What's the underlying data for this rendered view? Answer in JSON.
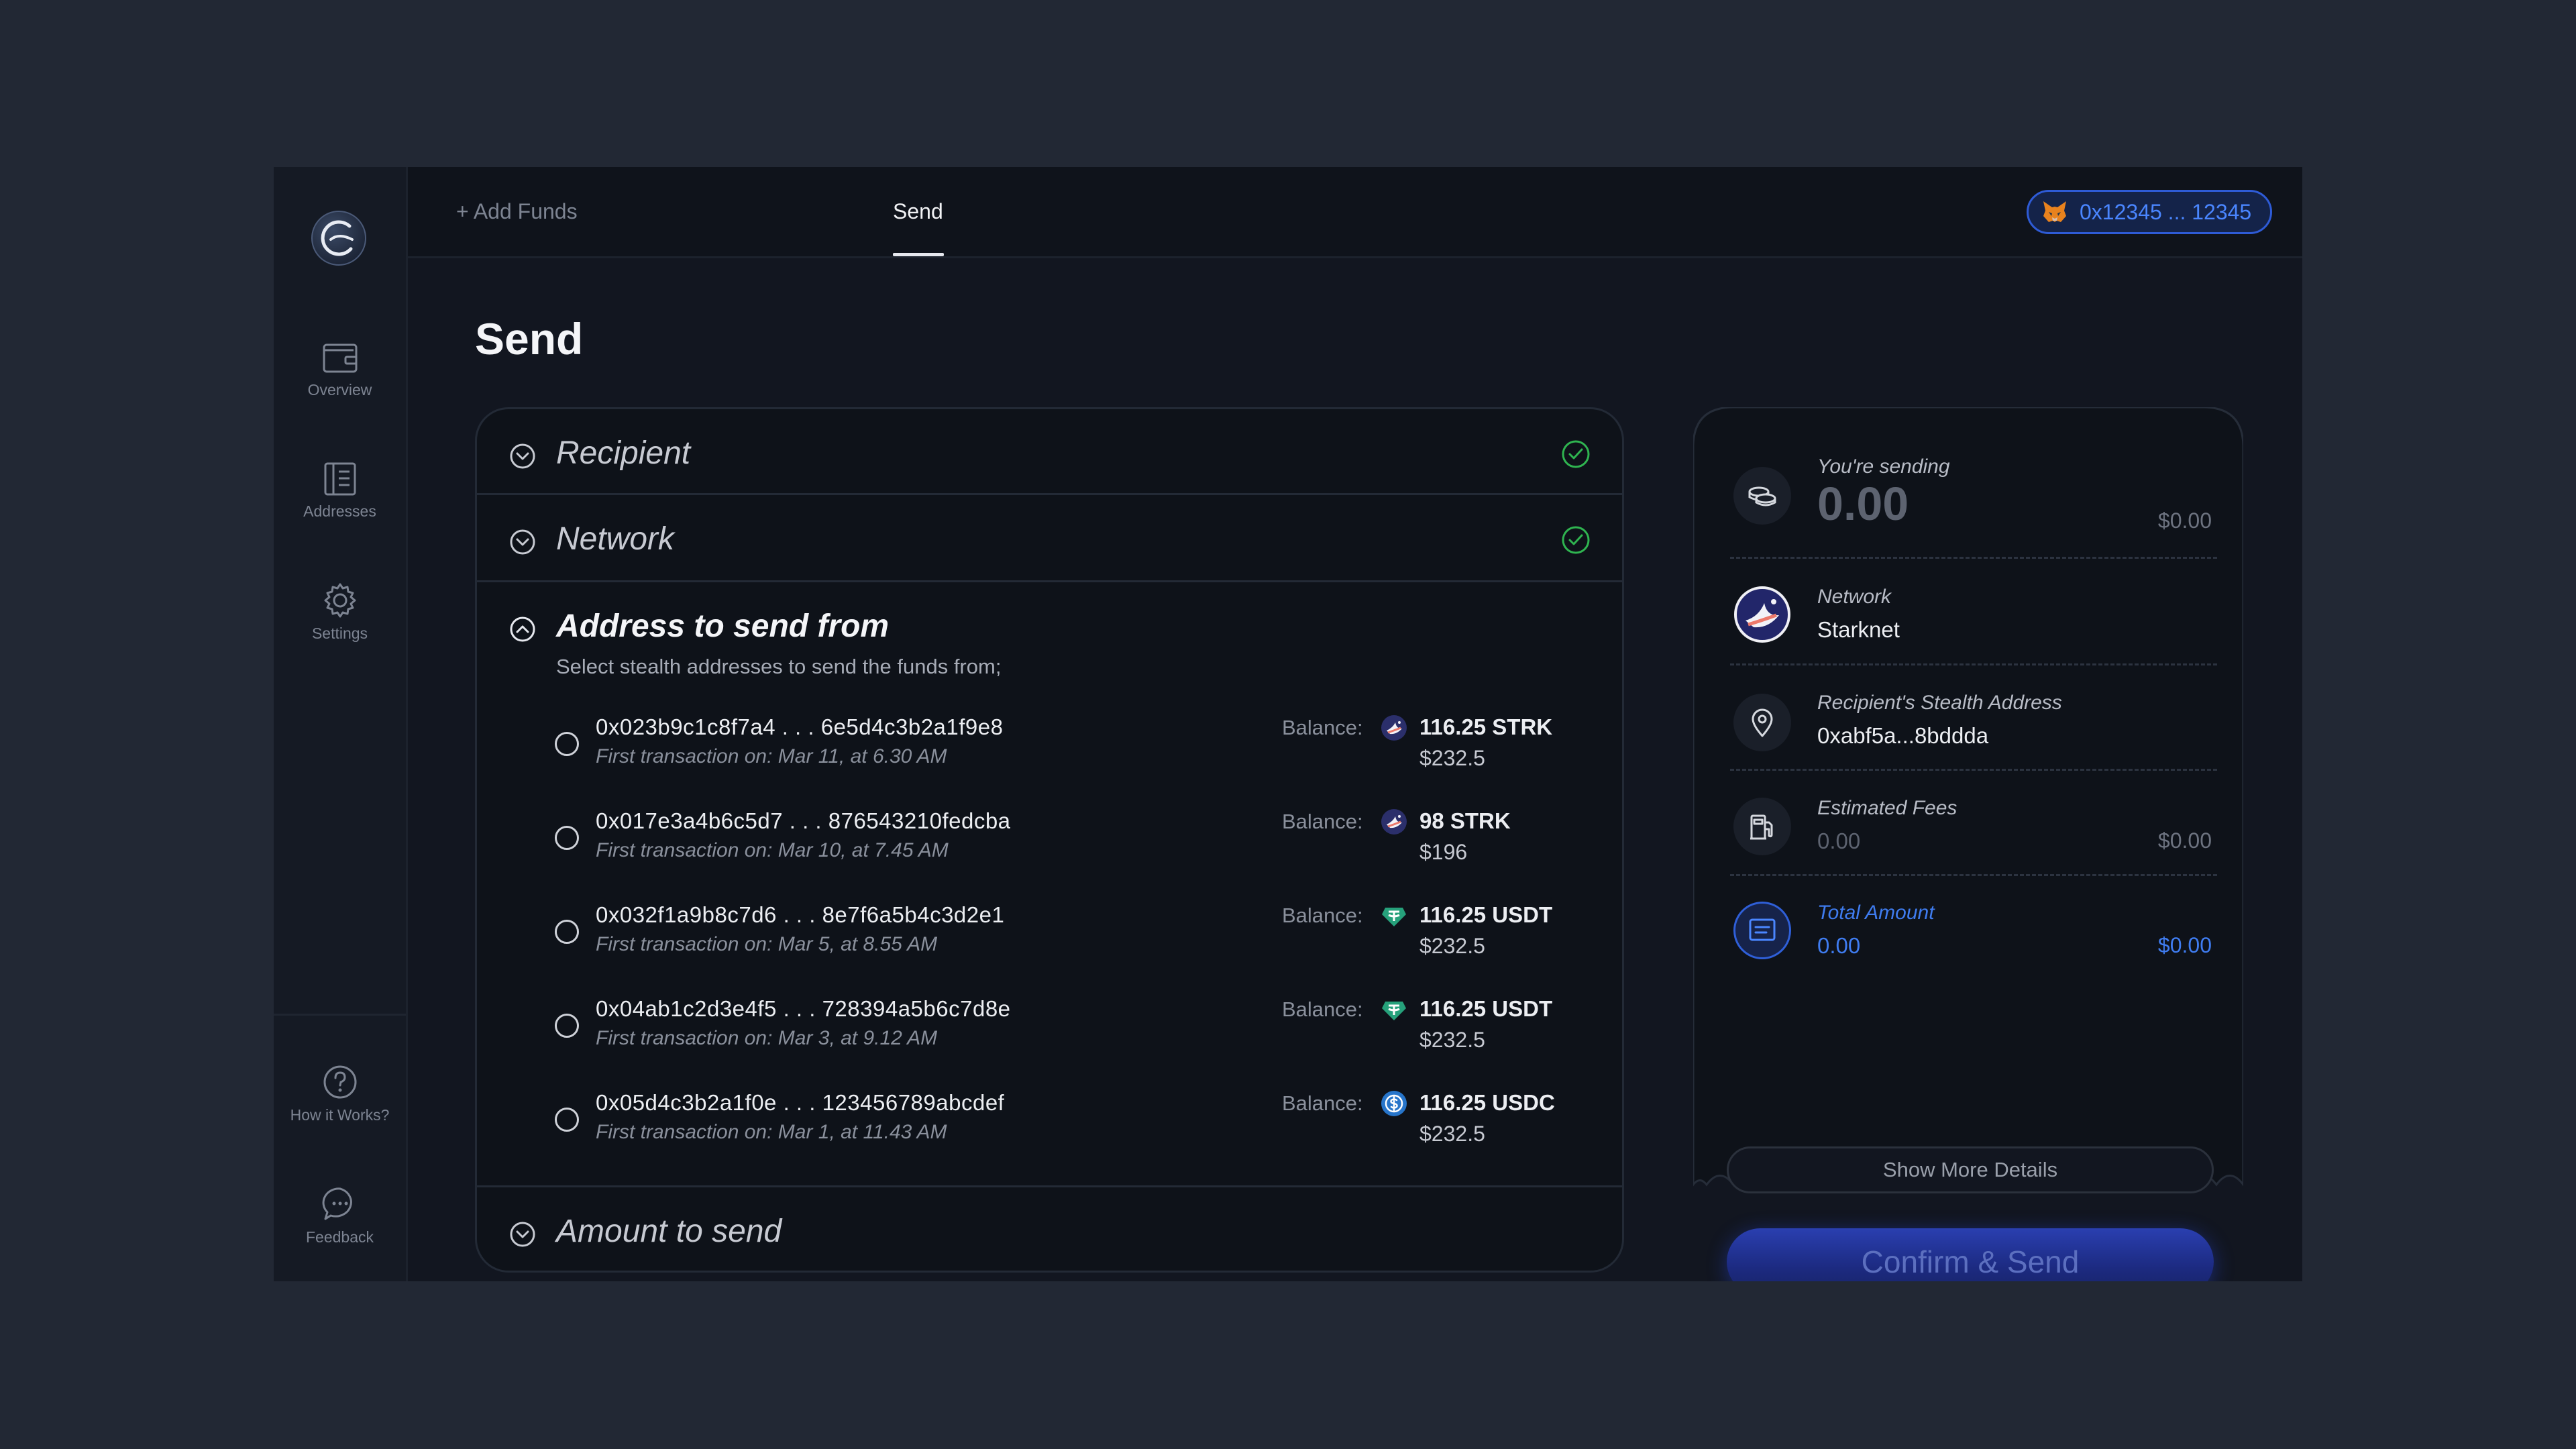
{
  "sidebar": {
    "items": [
      {
        "label": "Overview",
        "icon": "wallet-icon"
      },
      {
        "label": "Addresses",
        "icon": "addresses-icon"
      },
      {
        "label": "Settings",
        "icon": "gear-icon"
      }
    ],
    "bottom_items": [
      {
        "label": "How it Works?",
        "icon": "help-icon"
      },
      {
        "label": "Feedback",
        "icon": "feedback-icon"
      }
    ]
  },
  "topbar": {
    "tabs": [
      {
        "label": "+ Add Funds"
      },
      {
        "label": "Send",
        "active": true
      }
    ],
    "wallet": "0x12345 ... 12345"
  },
  "page": {
    "title": "Send"
  },
  "accordion": {
    "recipient": "Recipient",
    "network": "Network",
    "address_from": "Address to send from",
    "address_from_subtitle": "Select stealth addresses to send the funds from;",
    "amount": "Amount to send",
    "balance_label": "Balance:",
    "addresses": [
      {
        "address": "0x023b9c1c8f7a4 . . . 6e5d4c3b2a1f9e8",
        "first_tx": "First transaction on: Mar 11, at 6.30 AM",
        "token": "116.25 STRK",
        "usd": "$232.5",
        "token_icon": "starknet-icon"
      },
      {
        "address": "0x017e3a4b6c5d7 . . . 876543210fedcba",
        "first_tx": "First transaction on: Mar 10, at 7.45 AM",
        "token": "98 STRK",
        "usd": "$196",
        "token_icon": "starknet-icon"
      },
      {
        "address": "0x032f1a9b8c7d6 . . . 8e7f6a5b4c3d2e1",
        "first_tx": "First transaction on: Mar 5, at 8.55 AM",
        "token": "116.25 USDT",
        "usd": "$232.5",
        "token_icon": "usdt-icon"
      },
      {
        "address": "0x04ab1c2d3e4f5 . . . 728394a5b6c7d8e",
        "first_tx": "First transaction on: Mar 3, at 9.12 AM",
        "token": "116.25 USDT",
        "usd": "$232.5",
        "token_icon": "usdt-icon"
      },
      {
        "address": "0x05d4c3b2a1f0e . . . 123456789abcdef",
        "first_tx": "First transaction on: Mar 1, at 11.43 AM",
        "token": "116.25 USDC",
        "usd": "$232.5",
        "token_icon": "usdc-icon"
      }
    ]
  },
  "summary": {
    "sending_label": "You're sending",
    "sending_value": "0.00",
    "sending_usd": "$0.00",
    "network_label": "Network",
    "network_value": "Starknet",
    "recipient_label": "Recipient's Stealth Address",
    "recipient_value": "0xabf5a...8bddda",
    "fees_label": "Estimated Fees",
    "fees_value": "0.00",
    "fees_usd": "$0.00",
    "total_label": "Total Amount",
    "total_value": "0.00",
    "total_usd": "$0.00",
    "show_more": "Show More Details",
    "confirm": "Confirm & Send"
  },
  "colors": {
    "accent": "#2e5bd6",
    "success": "#2fb450",
    "total": "#3f7cf0",
    "usdt": "#26a17b",
    "usdc": "#2775ca"
  }
}
